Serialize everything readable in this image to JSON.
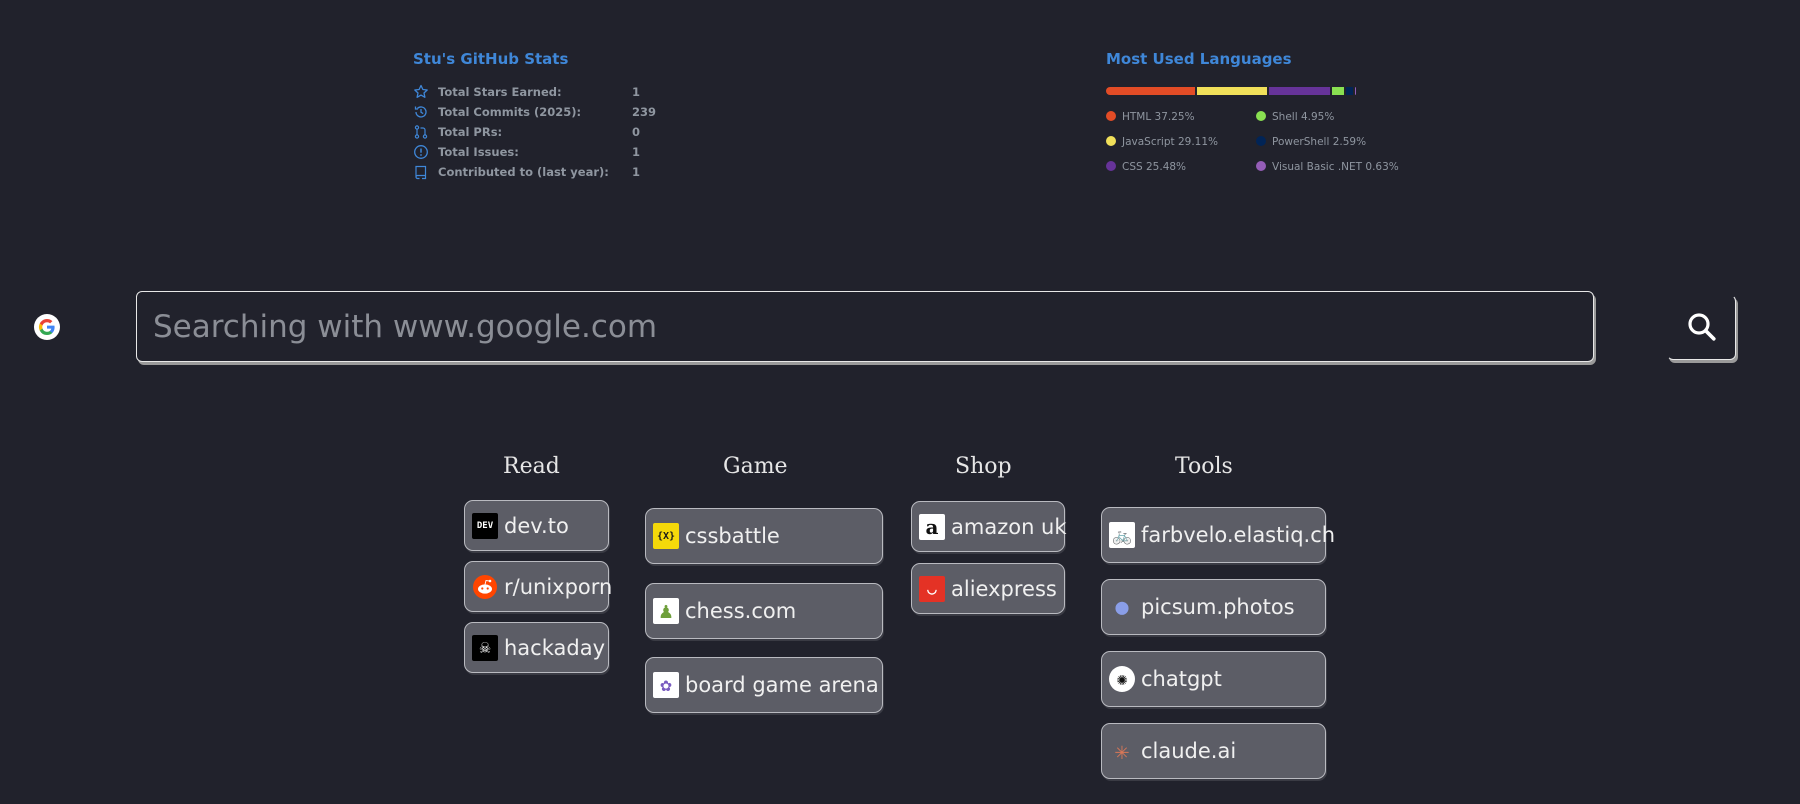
{
  "github_stats": {
    "title": "Stu's GitHub Stats",
    "rows": [
      {
        "icon": "star-icon",
        "label": "Total Stars Earned:",
        "value": "1"
      },
      {
        "icon": "history-icon",
        "label": "Total Commits (2025):",
        "value": "239"
      },
      {
        "icon": "pull-request-icon",
        "label": "Total PRs:",
        "value": "0"
      },
      {
        "icon": "issue-icon",
        "label": "Total Issues:",
        "value": "1"
      },
      {
        "icon": "repo-icon",
        "label": "Contributed to (last year):",
        "value": "1"
      }
    ]
  },
  "languages": {
    "title": "Most Used Languages",
    "items": [
      {
        "label": "HTML 37.25%",
        "percent": 37.25,
        "color": "#e34c26"
      },
      {
        "label": "JavaScript 29.11%",
        "percent": 29.11,
        "color": "#f1e05a"
      },
      {
        "label": "CSS 25.48%",
        "percent": 25.48,
        "color": "#663399"
      },
      {
        "label": "Shell 4.95%",
        "percent": 4.95,
        "color": "#89e051"
      },
      {
        "label": "PowerShell 2.59%",
        "percent": 2.59,
        "color": "#012456"
      },
      {
        "label": "Visual Basic .NET 0.63%",
        "percent": 0.63,
        "color": "#945db7"
      }
    ]
  },
  "search": {
    "engine_icon": "google-icon",
    "placeholder": "Searching with www.google.com",
    "value": "",
    "button_icon": "search-icon"
  },
  "bookmarks": {
    "read": {
      "title": "Read",
      "items": [
        {
          "label": "dev.to",
          "icon": "devto-icon",
          "glyph": "DEV"
        },
        {
          "label": "r/unixporn",
          "icon": "reddit-icon",
          "glyph": ""
        },
        {
          "label": "hackaday",
          "icon": "hackaday-icon",
          "glyph": "☠"
        }
      ]
    },
    "game": {
      "title": "Game",
      "items": [
        {
          "label": "cssbattle",
          "icon": "cssbattle-icon",
          "glyph": "{X}"
        },
        {
          "label": "chess.com",
          "icon": "chess-pawn-icon",
          "glyph": "♟"
        },
        {
          "label": "board game arena",
          "icon": "boardgamearena-icon",
          "glyph": "✿"
        }
      ]
    },
    "shop": {
      "title": "Shop",
      "items": [
        {
          "label": "amazon uk",
          "icon": "amazon-icon",
          "glyph": "a"
        },
        {
          "label": "aliexpress",
          "icon": "aliexpress-icon",
          "glyph": "◡"
        }
      ]
    },
    "tools": {
      "title": "Tools",
      "items": [
        {
          "label": "farbvelo.elastiq.ch",
          "icon": "bicycle-icon",
          "glyph": "🚲"
        },
        {
          "label": "picsum.photos",
          "icon": "picsum-icon",
          "glyph": "●"
        },
        {
          "label": "chatgpt",
          "icon": "chatgpt-icon",
          "glyph": "✺"
        },
        {
          "label": "claude.ai",
          "icon": "claude-icon",
          "glyph": "✳"
        }
      ]
    }
  }
}
